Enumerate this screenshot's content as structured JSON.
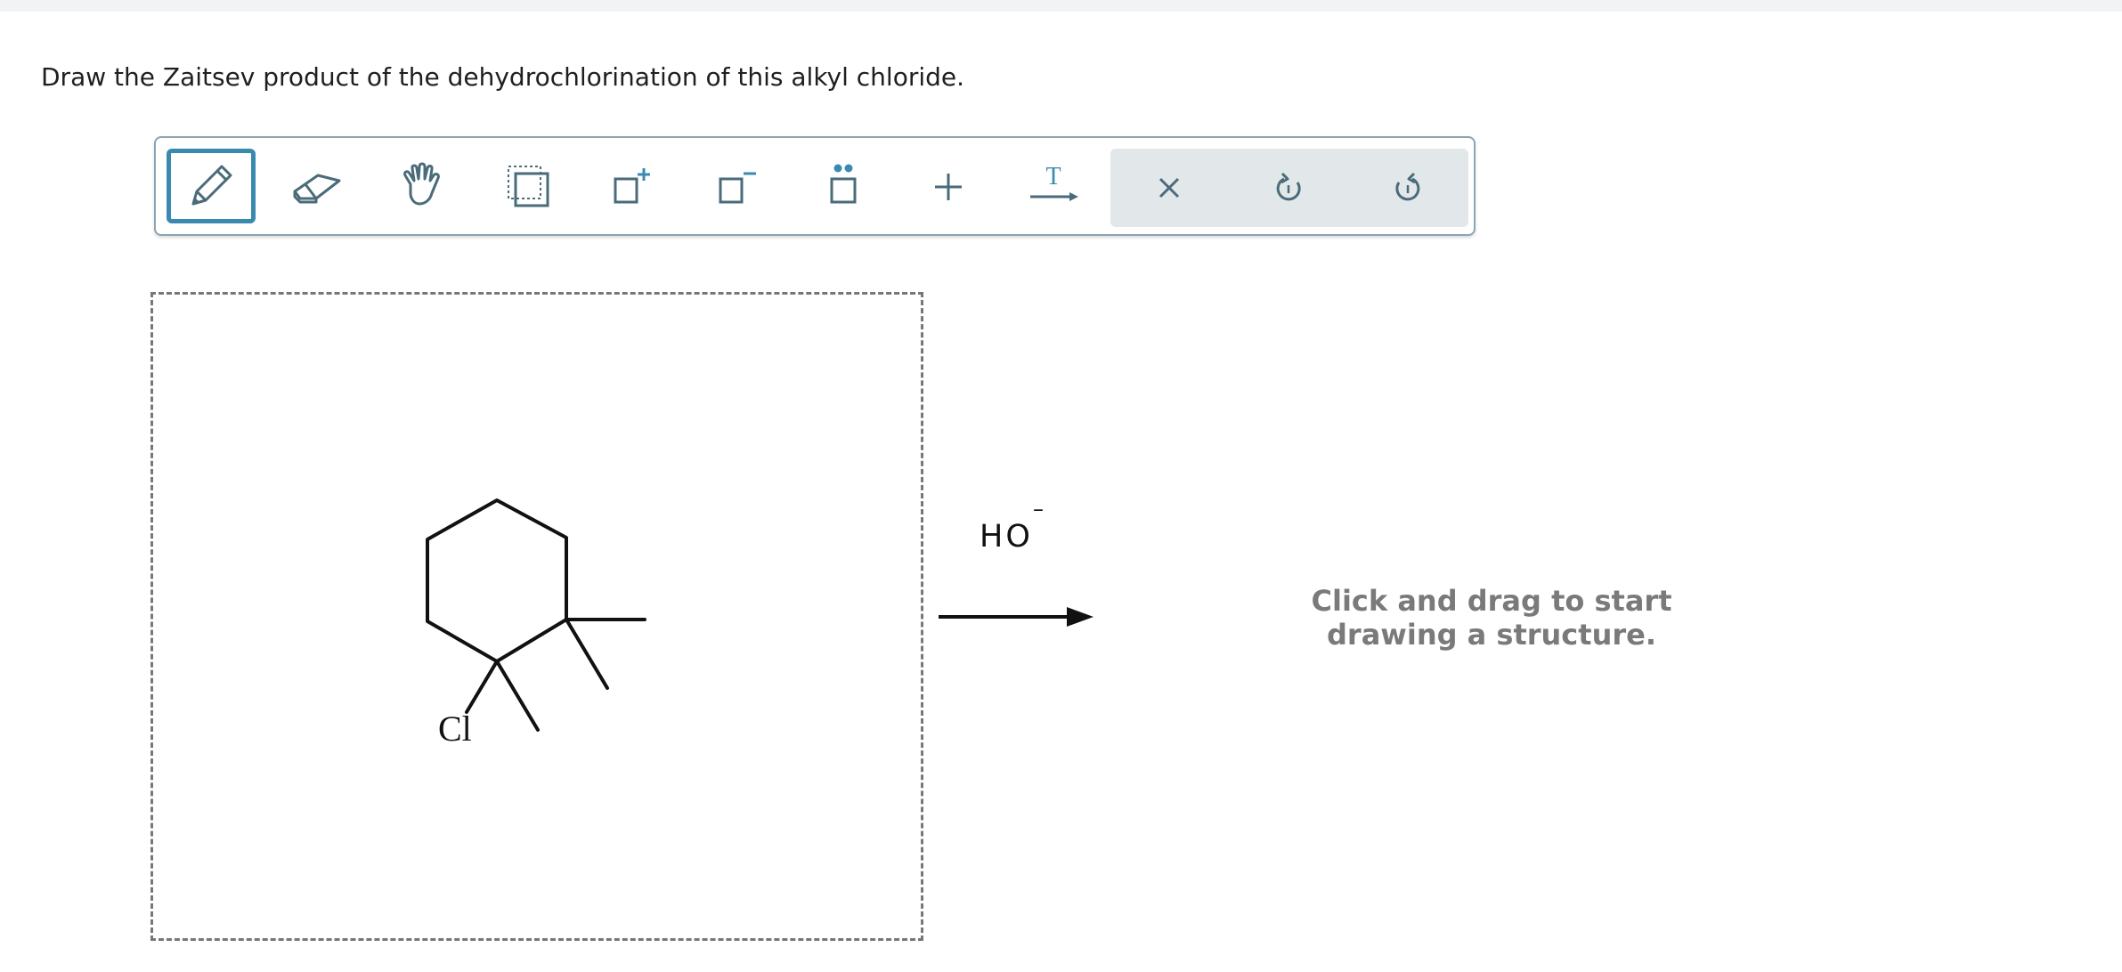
{
  "question": {
    "text": "Draw the Zaitsev product of the dehydrochlorination of this alkyl chloride."
  },
  "toolbar": {
    "tools": [
      {
        "name": "pencil",
        "icon": "pencil-icon",
        "active": true
      },
      {
        "name": "eraser",
        "icon": "eraser-icon",
        "active": false
      },
      {
        "name": "hand",
        "icon": "hand-icon",
        "active": false
      },
      {
        "name": "select",
        "icon": "select-box-icon",
        "active": false
      },
      {
        "name": "add-positive-charge",
        "icon": "positive-charge-icon",
        "active": false
      },
      {
        "name": "add-negative-charge",
        "icon": "negative-charge-icon",
        "active": false
      },
      {
        "name": "add-lone-pair",
        "icon": "lone-pair-icon",
        "active": false
      },
      {
        "name": "add-plus-sign",
        "icon": "plus-icon",
        "active": false
      },
      {
        "name": "text-arrow",
        "icon": "text-arrow-icon",
        "active": false
      },
      {
        "name": "clear",
        "icon": "close-icon",
        "active": false
      },
      {
        "name": "undo",
        "icon": "undo-icon",
        "active": false
      },
      {
        "name": "redo",
        "icon": "redo-icon",
        "active": false
      }
    ],
    "text_tool_letter": "T"
  },
  "reaction": {
    "reagent": "HO",
    "reagent_charge": "–",
    "reactant_atom_label": "Cl"
  },
  "product_area": {
    "hint_line1": "Click and drag to start",
    "hint_line2": "drawing a structure."
  },
  "colors": {
    "accent": "#3a8ab0",
    "icon": "#4a6b7a",
    "hint": "#7a7a7a",
    "border": "#8aa5b3"
  }
}
